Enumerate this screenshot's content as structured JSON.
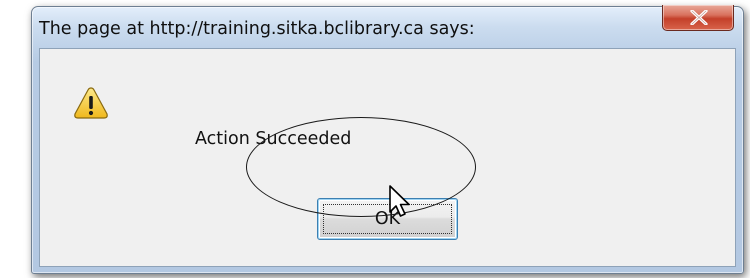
{
  "dialog": {
    "title": "The page at http://training.sitka.bclibrary.ca says:",
    "close_icon": "close-x-icon",
    "icon": "warning-icon",
    "message": "Action Succeeded",
    "ok_label": "OK"
  },
  "annotation": {
    "shape": "ellipse",
    "color": "#1a1a1a"
  },
  "cursor": {
    "icon": "arrow-pointer-icon"
  },
  "colors": {
    "titlebar": "#c9dbef",
    "client_area": "#f0f0f0",
    "close_button": "#c7412b",
    "focus_border": "#3c7fb1",
    "warning_fill": "#f4c331"
  }
}
